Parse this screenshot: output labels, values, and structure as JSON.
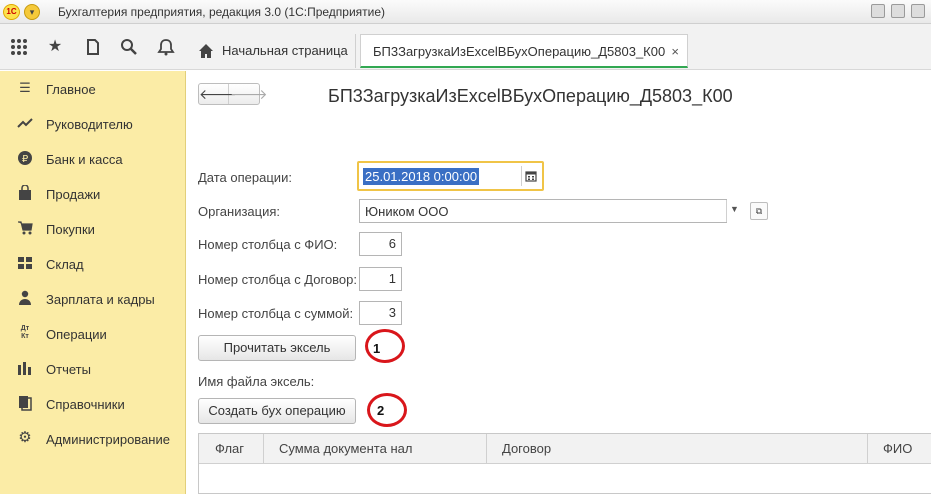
{
  "titlebar": {
    "logo": "1С",
    "title": "Бухгалтерия предприятия, редакция 3.0  (1С:Предприятие)"
  },
  "toolbar": {
    "icons": [
      "apps-grid-icon",
      "star-icon",
      "history-icon",
      "search-icon",
      "bell-icon"
    ],
    "tabs": [
      {
        "label": "Начальная страница",
        "icon": "home-icon"
      },
      {
        "label": "БП3ЗагрузкаИзExcelВБухОперацию_Д5803_К00",
        "close": "×"
      }
    ]
  },
  "sidebar": {
    "items": [
      {
        "label": "Главное",
        "icon": "menu-lines-icon"
      },
      {
        "label": "Руководителю",
        "icon": "trend-icon"
      },
      {
        "label": "Банк и касса",
        "icon": "coin-icon"
      },
      {
        "label": "Продажи",
        "icon": "shopping-bag-icon"
      },
      {
        "label": "Покупки",
        "icon": "cart-icon"
      },
      {
        "label": "Склад",
        "icon": "warehouse-grid-icon"
      },
      {
        "label": "Зарплата и кадры",
        "icon": "person-icon"
      },
      {
        "label": "Операции",
        "icon": "dt-kt-icon",
        "icon_text": "Дт Кт"
      },
      {
        "label": "Отчеты",
        "icon": "bar-chart-icon"
      },
      {
        "label": "Справочники",
        "icon": "books-icon"
      },
      {
        "label": "Администрирование",
        "icon": "gear-icon"
      }
    ]
  },
  "form": {
    "title": "БП3ЗагрузкаИзExcelВБухОперацию_Д5803_К00",
    "nav": {
      "back": "🡐",
      "forward": "🡒"
    },
    "date_label": "Дата операции:",
    "date_value": "25.01.2018  0:00:00",
    "org_label": "Организация:",
    "org_value": "Юником ООО",
    "fio_col_label": "Номер столбца с ФИО:",
    "fio_col_value": "6",
    "contract_col_label": "Номер столбца с Договор:",
    "contract_col_value": "1",
    "sum_col_label": "Номер столбца с суммой:",
    "sum_col_value": "3",
    "read_button": "Прочитать эксель",
    "file_label": "Имя файла эксель:",
    "create_button": "Создать бух операцию",
    "annotation_1": "1",
    "annotation_2": "2",
    "accent_color": "#f0c447",
    "annotation_color": "#d9161b"
  },
  "table": {
    "columns": [
      "Флаг",
      "Сумма документа нал",
      "Договор",
      "ФИО"
    ]
  }
}
